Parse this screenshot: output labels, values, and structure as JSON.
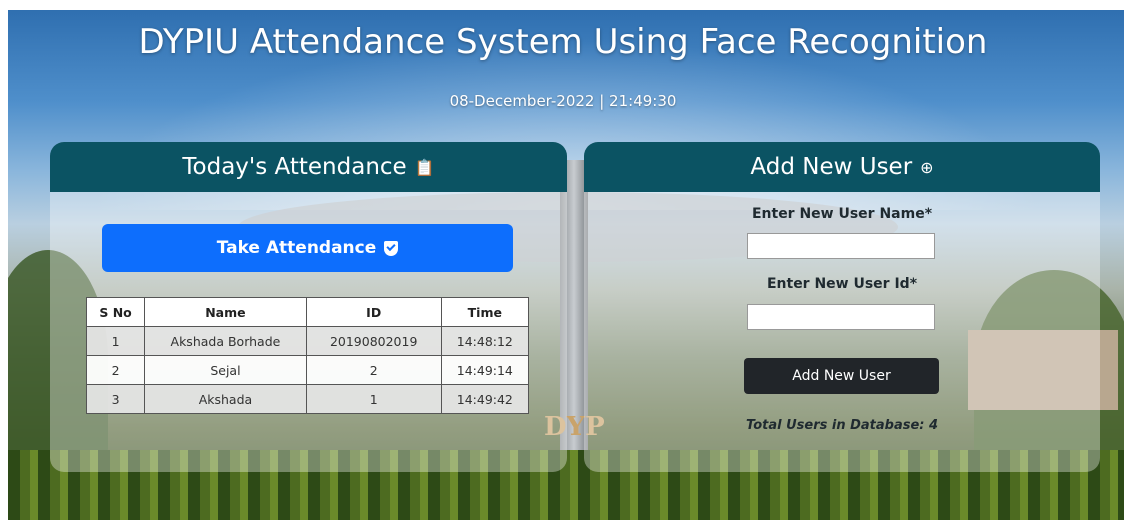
{
  "header": {
    "title": "DYPIU Attendance System Using Face Recognition",
    "datetime": "08-December-2022 | 21:49:30"
  },
  "attendance_panel": {
    "heading": "Today's Attendance",
    "heading_icon": "clipboard-icon",
    "take_button_label": "Take Attendance",
    "take_button_icon": "shield-check-icon",
    "table": {
      "columns": [
        "S No",
        "Name",
        "ID",
        "Time"
      ],
      "rows": [
        [
          "1",
          "Akshada Borhade",
          "20190802019",
          "14:48:12"
        ],
        [
          "2",
          "Sejal",
          "2",
          "14:49:14"
        ],
        [
          "3",
          "Akshada",
          "1",
          "14:49:42"
        ]
      ]
    }
  },
  "add_user_panel": {
    "heading": "Add New User",
    "heading_icon": "plus-circle-icon",
    "name_label": "Enter New User Name*",
    "name_value": "",
    "id_label": "Enter New User Id*",
    "id_value": "",
    "submit_label": "Add New User",
    "total_users": "Total Users in Database: 4"
  },
  "colors": {
    "panel_header": "#0b5363",
    "primary_button": "#0d6efd",
    "dark_button": "#212529"
  }
}
